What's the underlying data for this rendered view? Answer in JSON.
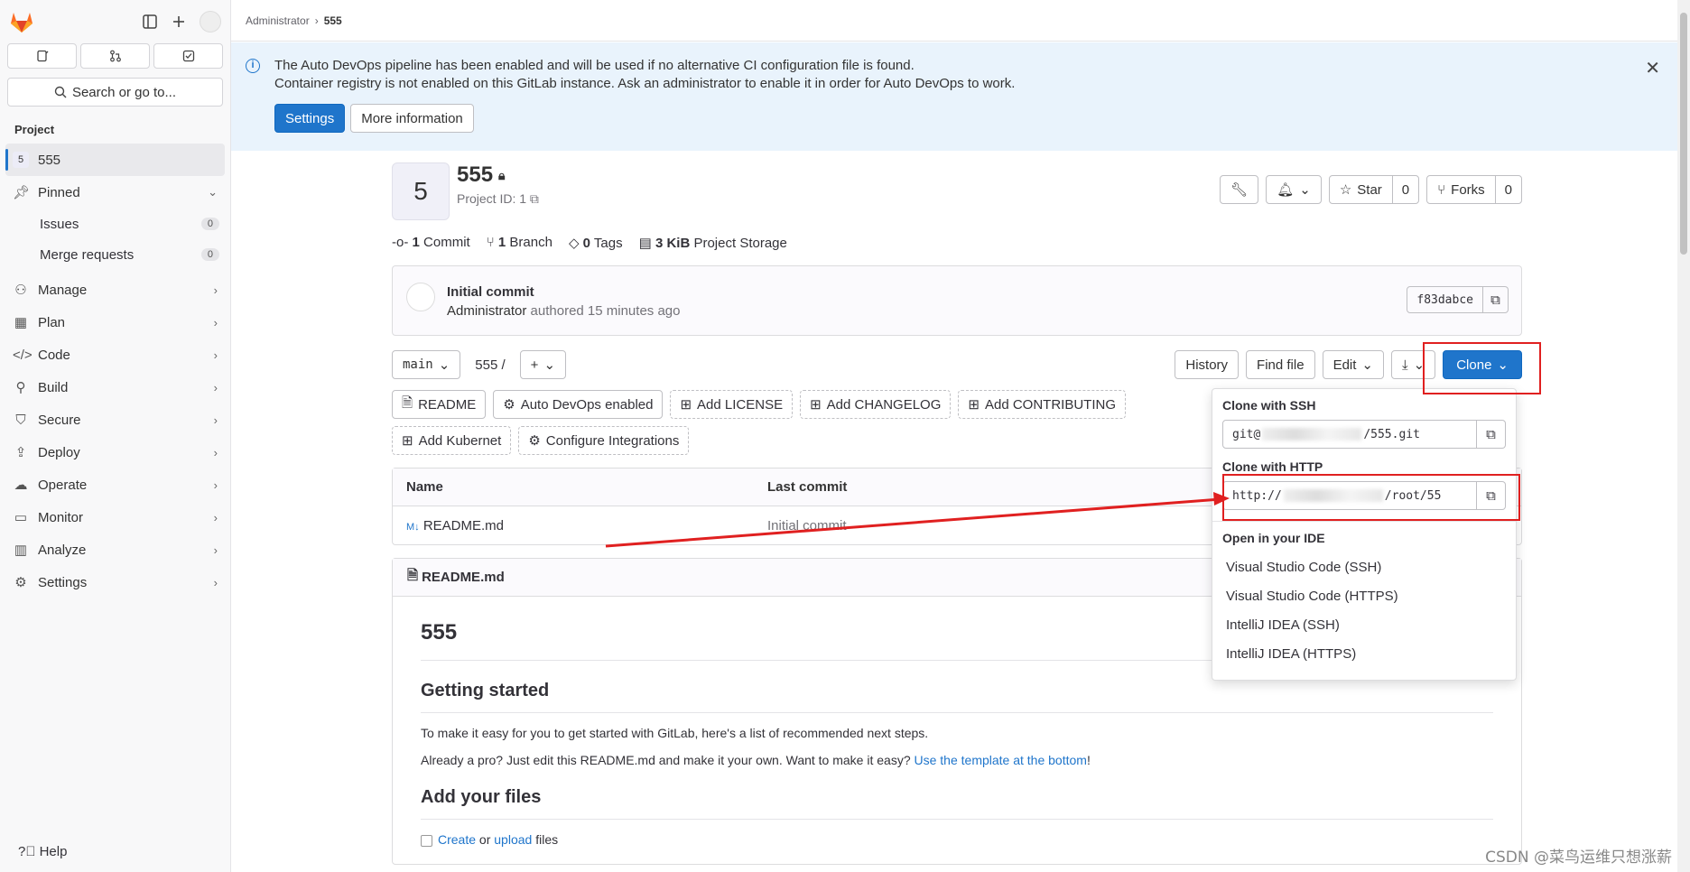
{
  "sidebar": {
    "search_label": "Search or go to...",
    "section_label": "Project",
    "project_badge": "5",
    "project_name": "555",
    "pinned": "Pinned",
    "issues": {
      "label": "Issues",
      "count": "0"
    },
    "merge_requests": {
      "label": "Merge requests",
      "count": "0"
    },
    "items": [
      {
        "label": "Manage"
      },
      {
        "label": "Plan"
      },
      {
        "label": "Code"
      },
      {
        "label": "Build"
      },
      {
        "label": "Secure"
      },
      {
        "label": "Deploy"
      },
      {
        "label": "Operate"
      },
      {
        "label": "Monitor"
      },
      {
        "label": "Analyze"
      },
      {
        "label": "Settings"
      }
    ],
    "help": "Help"
  },
  "breadcrumb": {
    "root": "Administrator",
    "current": "555"
  },
  "alert": {
    "line1": "The Auto DevOps pipeline has been enabled and will be used if no alternative CI configuration file is found.",
    "line2": "Container registry is not enabled on this GitLab instance. Ask an administrator to enable it in order for Auto DevOps to work.",
    "settings_btn": "Settings",
    "more_btn": "More information"
  },
  "project": {
    "avatar_letter": "5",
    "name": "555",
    "id_label": "Project ID: 1",
    "star_label": "Star",
    "star_count": "0",
    "forks_label": "Forks",
    "forks_count": "0"
  },
  "stats": {
    "commits_n": "1",
    "commits_label": "Commit",
    "branches_n": "1",
    "branches_label": "Branch",
    "tags_n": "0",
    "tags_label": "Tags",
    "storage_n": "3 KiB",
    "storage_label": "Project Storage"
  },
  "commit": {
    "title": "Initial commit",
    "author": "Administrator",
    "meta": "authored 15 minutes ago",
    "sha": "f83dabce"
  },
  "toolbar": {
    "branch": "main",
    "path": "555",
    "path_sep": "/",
    "history": "History",
    "find_file": "Find file",
    "edit": "Edit",
    "clone": "Clone"
  },
  "chips": [
    "README",
    "Auto DevOps enabled",
    "Add LICENSE",
    "Add CHANGELOG",
    "Add CONTRIBUTING",
    "Add Kubernet",
    "Configure Integrations"
  ],
  "files": {
    "col_name": "Name",
    "col_commit": "Last commit",
    "rows": [
      {
        "name": "README.md",
        "commit": "Initial commit"
      }
    ]
  },
  "readme": {
    "file": "README.md",
    "h1": "555",
    "h2a": "Getting started",
    "p1": "To make it easy for you to get started with GitLab, here's a list of recommended next steps.",
    "p2": "Already a pro? Just edit this README.md and make it your own. Want to make it easy?",
    "p2_link": "Use the template at the bottom",
    "p2_end": "!",
    "h2b": "Add your files",
    "create": "Create",
    "or": "or",
    "upload": "upload",
    "files": "files"
  },
  "clone_dropdown": {
    "ssh_label": "Clone with SSH",
    "ssh_prefix": "git@",
    "ssh_suffix": "/555.git",
    "http_label": "Clone with HTTP",
    "http_prefix": "http://",
    "http_suffix": "/root/55",
    "ide_label": "Open in your IDE",
    "ide_items": [
      "Visual Studio Code (SSH)",
      "Visual Studio Code (HTTPS)",
      "IntelliJ IDEA (SSH)",
      "IntelliJ IDEA (HTTPS)"
    ]
  },
  "watermark": "CSDN @菜鸟运维只想涨薪",
  "colors": {
    "accent": "#1f75cb",
    "annotation": "#e02020",
    "alert_bg": "#e9f3fc"
  }
}
